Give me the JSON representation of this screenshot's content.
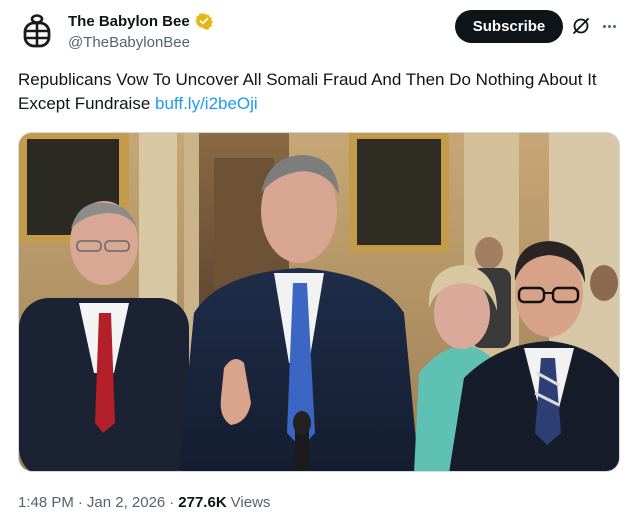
{
  "author": {
    "display_name": "The Babylon Bee",
    "handle": "@TheBabylonBee",
    "verified": true,
    "avatar_icon": "bee-logo-icon",
    "verified_color": "#e2b719"
  },
  "actions": {
    "subscribe_label": "Subscribe",
    "grok_icon": "grok-icon",
    "more_icon": "more-dots-icon"
  },
  "tweet": {
    "text": "Republicans Vow To Uncover All Somali Fraud And Then Do Nothing About It Except Fundraise ",
    "link_text": "buff.ly/i2beOji"
  },
  "media": {
    "type": "photo",
    "alt": "Press conference photo"
  },
  "meta": {
    "time": "1:48 PM",
    "separator": "·",
    "date": "Jan 2, 2026",
    "views_count": "277.6K",
    "views_label": "Views"
  },
  "colors": {
    "link": "#1d9bf0",
    "text": "#0f1419",
    "secondary": "#536471"
  }
}
